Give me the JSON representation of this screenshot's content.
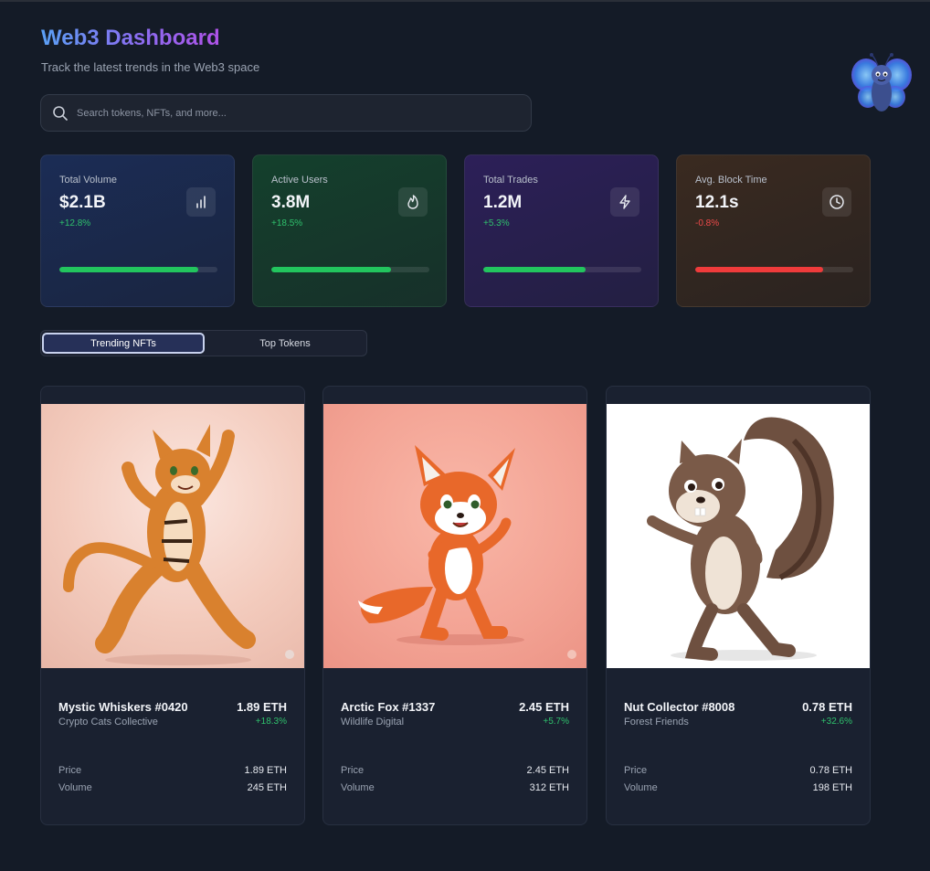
{
  "header": {
    "title": "Web3 Dashboard",
    "subtitle": "Track the latest trends in the Web3 space"
  },
  "search": {
    "placeholder": "Search tokens, NFTs, and more..."
  },
  "stats": [
    {
      "label": "Total Volume",
      "value": "$2.1B",
      "change": "+12.8%",
      "icon": "bar-chart-icon",
      "progress": 0.88,
      "trend": "positive"
    },
    {
      "label": "Active Users",
      "value": "3.8M",
      "change": "+18.5%",
      "icon": "flame-icon",
      "progress": 0.76,
      "trend": "positive"
    },
    {
      "label": "Total Trades",
      "value": "1.2M",
      "change": "+5.3%",
      "icon": "lightning-icon",
      "progress": 0.65,
      "trend": "positive"
    },
    {
      "label": "Avg. Block Time",
      "value": "12.1s",
      "change": "-0.8%",
      "icon": "clock-icon",
      "progress": 0.81,
      "trend": "negative"
    }
  ],
  "tabs": [
    {
      "label": "Trending NFTs",
      "active": true
    },
    {
      "label": "Top Tokens",
      "active": false
    }
  ],
  "nfts": [
    {
      "name": "Mystic Whiskers #0420",
      "collection": "Crypto Cats Collective",
      "price": "1.89 ETH",
      "change": "+18.3%",
      "price_label": "Price",
      "price_value": "1.89 ETH",
      "volume_label": "Volume",
      "volume_value": "245 ETH",
      "image": "dancing-tiger-cat"
    },
    {
      "name": "Arctic Fox #1337",
      "collection": "Wildlife Digital",
      "price": "2.45 ETH",
      "change": "+5.7%",
      "price_label": "Price",
      "price_value": "2.45 ETH",
      "volume_label": "Volume",
      "volume_value": "312 ETH",
      "image": "dancing-fox"
    },
    {
      "name": "Nut Collector #8008",
      "collection": "Forest Friends",
      "price": "0.78 ETH",
      "change": "+32.6%",
      "price_label": "Price",
      "price_value": "0.78 ETH",
      "volume_label": "Volume",
      "volume_value": "198 ETH",
      "image": "dancing-squirrel"
    }
  ],
  "colors": {
    "accent_gradient_start": "#5aa0f5",
    "accent_gradient_end": "#b052e8",
    "positive": "#2fc06c",
    "negative": "#ef4a4a",
    "background": "#141b27"
  }
}
